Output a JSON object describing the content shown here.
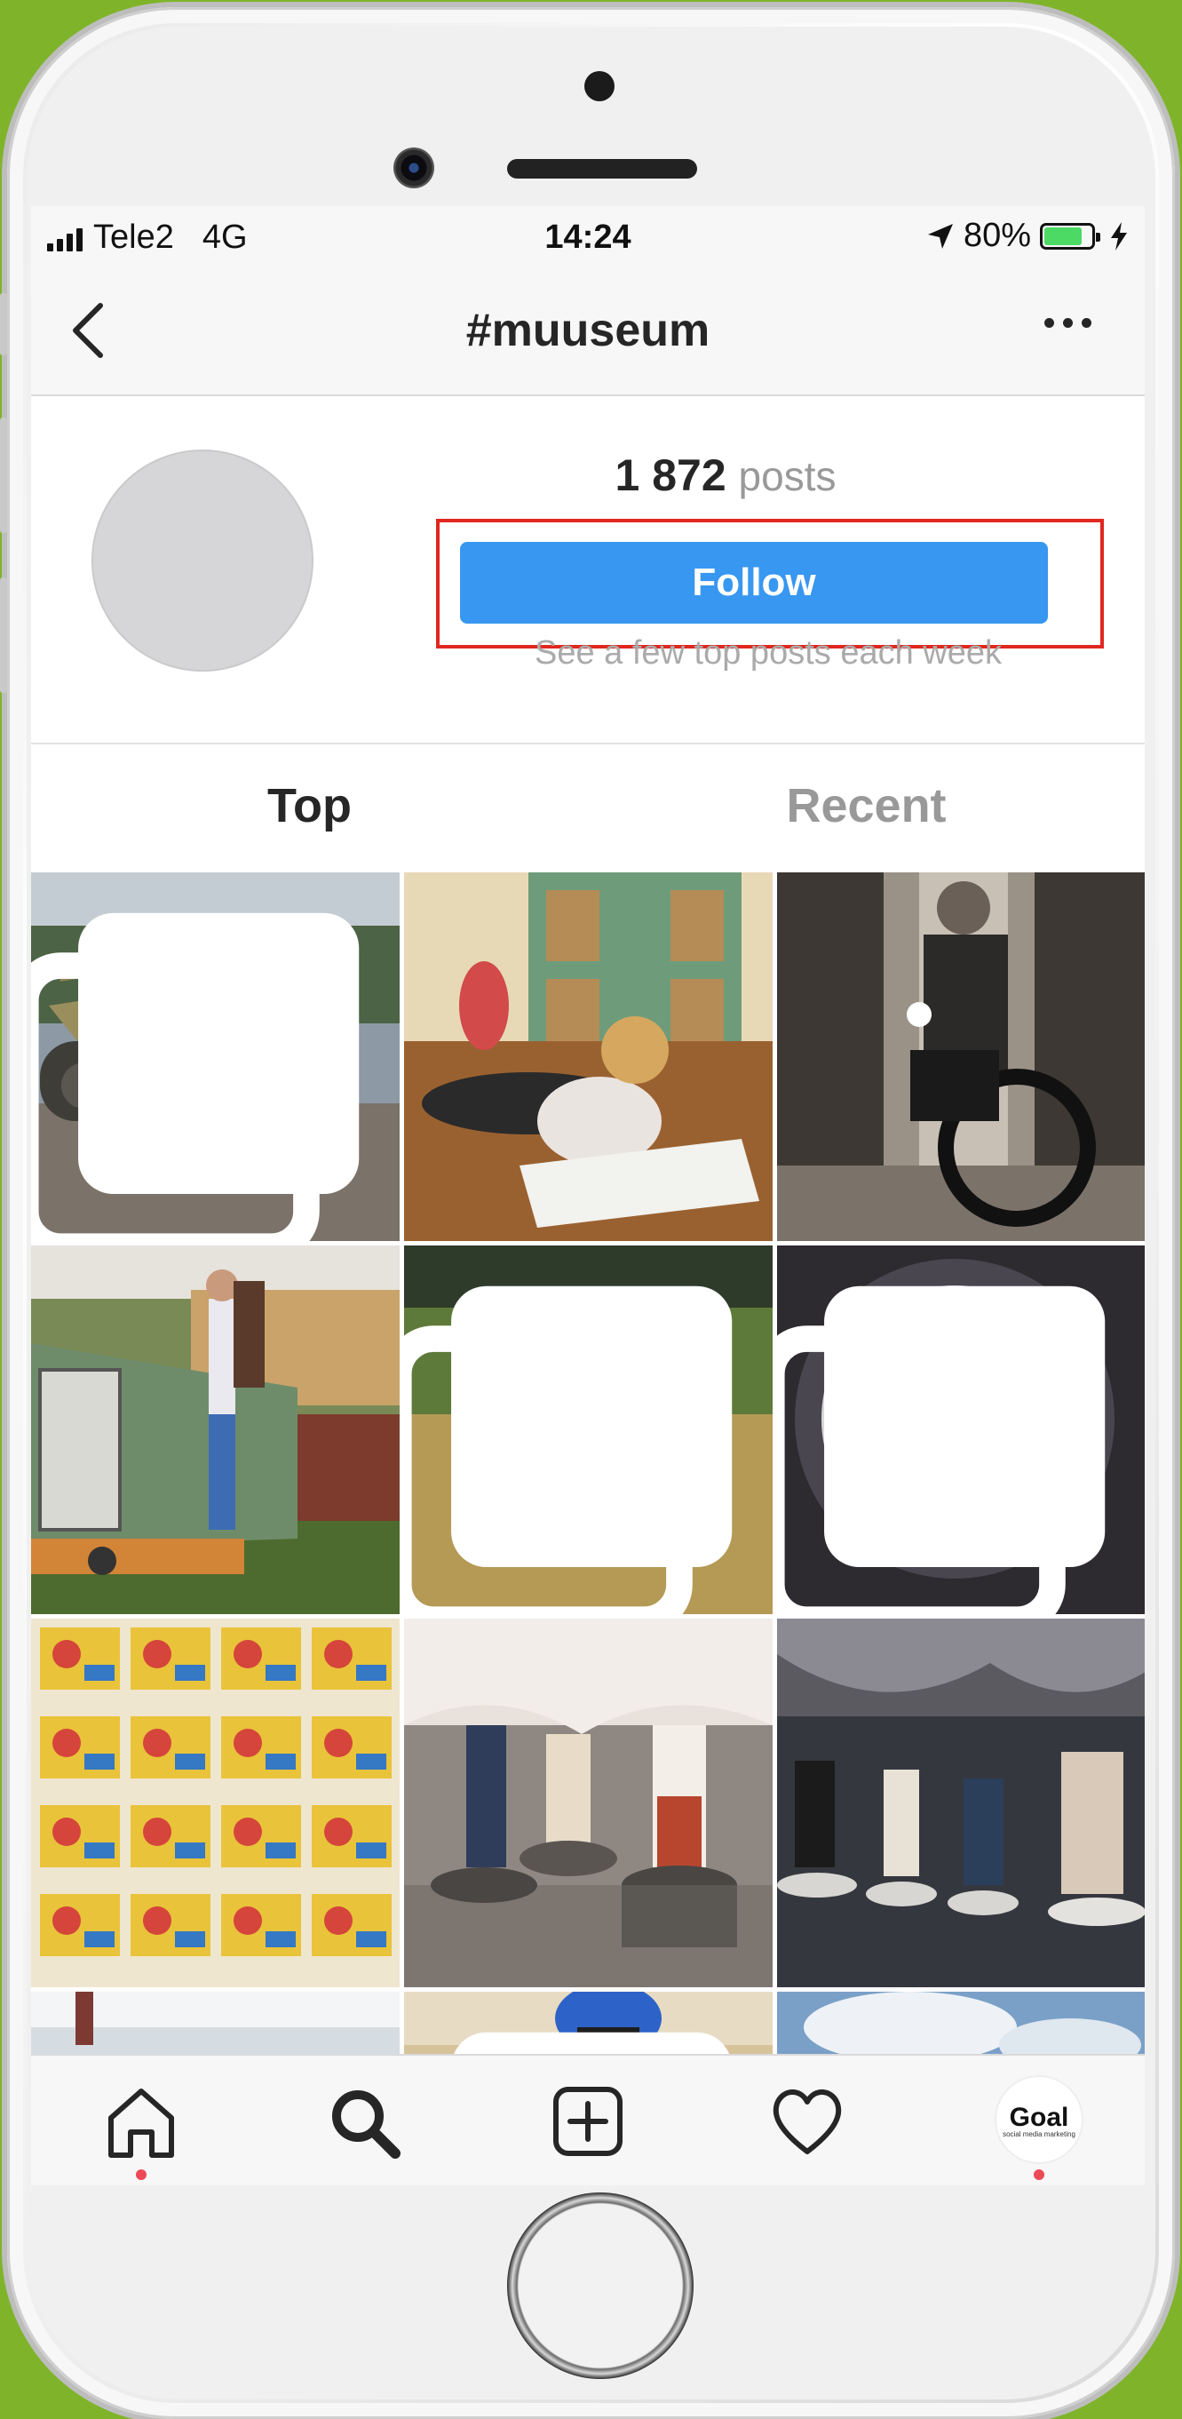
{
  "status_bar": {
    "carrier": "Tele2",
    "network": "4G",
    "time": "14:24",
    "battery_percent": "80%",
    "battery_level": 0.8,
    "location_icon": "location-arrow-icon",
    "charging_icon": "charging-bolt-icon"
  },
  "header": {
    "title": "#muuseum",
    "back_icon": "chevron-left-icon",
    "more_icon": "more-dots-icon"
  },
  "profile": {
    "posts_count": "1 872",
    "posts_label": "posts",
    "follow_label": "Follow",
    "follow_subtitle": "See a few top posts each week"
  },
  "tabs": [
    {
      "label": "Top",
      "active": true
    },
    {
      "label": "Recent",
      "active": false
    }
  ],
  "grid": {
    "tiles": [
      {
        "subject": "tank-photo",
        "multi": true
      },
      {
        "subject": "child-drawing-photo",
        "multi": false
      },
      {
        "subject": "motorcycle-photo",
        "multi": false
      },
      {
        "subject": "locomotive-photo",
        "multi": false
      },
      {
        "subject": "field-man-photo",
        "multi": true
      },
      {
        "subject": "porthole-exhibit-photo",
        "multi": true
      },
      {
        "subject": "poster-wall-photo",
        "multi": false
      },
      {
        "subject": "costumes-photo",
        "multi": false
      },
      {
        "subject": "costumes-dark-photo",
        "multi": false
      },
      {
        "subject": "partial-photo-1",
        "multi": false
      },
      {
        "subject": "partial-photo-2",
        "multi": true
      },
      {
        "subject": "partial-photo-3",
        "multi": false
      }
    ]
  },
  "bottom_nav": {
    "items": [
      "home-icon",
      "search-icon",
      "add-post-icon",
      "heart-icon",
      "profile-avatar"
    ],
    "profile_logo_text": "Goal",
    "profile_logo_tagline": "social media marketing"
  },
  "colors": {
    "follow_button": "#3897f0",
    "highlight_box": "#e0281e",
    "notification_dot": "#ed4956",
    "battery_fill": "#4cd964",
    "background": "#7fb42a"
  }
}
